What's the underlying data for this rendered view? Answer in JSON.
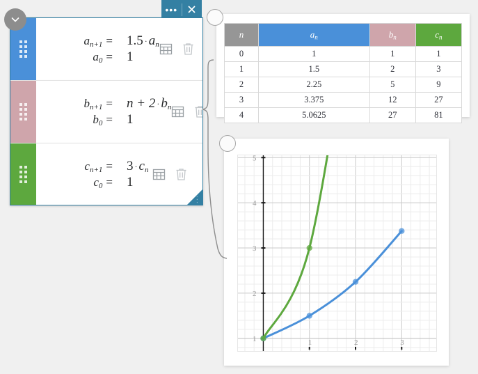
{
  "window": {
    "title_buttons": [
      {
        "name": "more-options",
        "glyph": "•••"
      },
      {
        "name": "close",
        "glyph": "✕"
      }
    ],
    "collapse_icon": "chevron-down-icon",
    "resize_handle": "resize-handle"
  },
  "formulas": [
    {
      "color": "#4a90d9",
      "var": "a",
      "recurrence_lhs": "a",
      "recurrence_lhs_sub": "n+1",
      "recurrence_rhs_text": "1.5",
      "recurrence_rhs_op": "·",
      "recurrence_rhs_var": "a",
      "recurrence_rhs_var_sub": "n",
      "initial_lhs": "a",
      "initial_lhs_sub": "0",
      "initial_value": "1",
      "equals": "=",
      "table_tool": "table-icon",
      "delete_tool": "trash-icon"
    },
    {
      "color": "#cfa5ab",
      "var": "b",
      "recurrence_lhs": "b",
      "recurrence_lhs_sub": "n+1",
      "recurrence_rhs_text": "n + 2",
      "recurrence_rhs_op": "·",
      "recurrence_rhs_var": "b",
      "recurrence_rhs_var_sub": "n",
      "initial_lhs": "b",
      "initial_lhs_sub": "0",
      "initial_value": "1",
      "equals": "=",
      "table_tool": "table-icon",
      "delete_tool": "trash-icon"
    },
    {
      "color": "#5da83e",
      "var": "c",
      "recurrence_lhs": "c",
      "recurrence_lhs_sub": "n+1",
      "recurrence_rhs_text": "3",
      "recurrence_rhs_op": "·",
      "recurrence_rhs_var": "c",
      "recurrence_rhs_var_sub": "n",
      "initial_lhs": "c",
      "initial_lhs_sub": "0",
      "initial_value": "1",
      "equals": "=",
      "table_tool": "table-icon",
      "delete_tool": "trash-icon"
    }
  ],
  "table": {
    "headers": [
      {
        "text": "n",
        "sub": "",
        "color": "#969696"
      },
      {
        "text": "a",
        "sub": "n",
        "color": "#4a90d9"
      },
      {
        "text": "b",
        "sub": "n",
        "color": "#cfa5ab"
      },
      {
        "text": "c",
        "sub": "n",
        "color": "#5da83e"
      }
    ],
    "rows": [
      [
        "0",
        "1",
        "1",
        "1"
      ],
      [
        "1",
        "1.5",
        "2",
        "3"
      ],
      [
        "2",
        "2.25",
        "5",
        "9"
      ],
      [
        "3",
        "3.375",
        "12",
        "27"
      ],
      [
        "4",
        "5.0625",
        "27",
        "81"
      ]
    ]
  },
  "chart_data": {
    "type": "line",
    "title": "",
    "xlabel": "",
    "ylabel": "",
    "xlim": [
      -0.55,
      3.75
    ],
    "ylim": [
      0.72,
      5.05
    ],
    "xticks": [
      "1",
      "2",
      "3"
    ],
    "yticks": [
      "1",
      "2",
      "3",
      "4",
      "5"
    ],
    "grid": true,
    "legend": "none",
    "series": [
      {
        "name": "a_n",
        "color": "#4a90d9",
        "x": [
          0,
          1,
          2,
          3
        ],
        "y": [
          1,
          1.5,
          2.25,
          3.375
        ],
        "points_shown": [
          0,
          1,
          2,
          3
        ]
      },
      {
        "name": "c_n",
        "color": "#5da83e",
        "x": [
          0,
          1,
          2
        ],
        "y": [
          1,
          3,
          9
        ],
        "points_shown": [
          0,
          1
        ]
      }
    ]
  }
}
